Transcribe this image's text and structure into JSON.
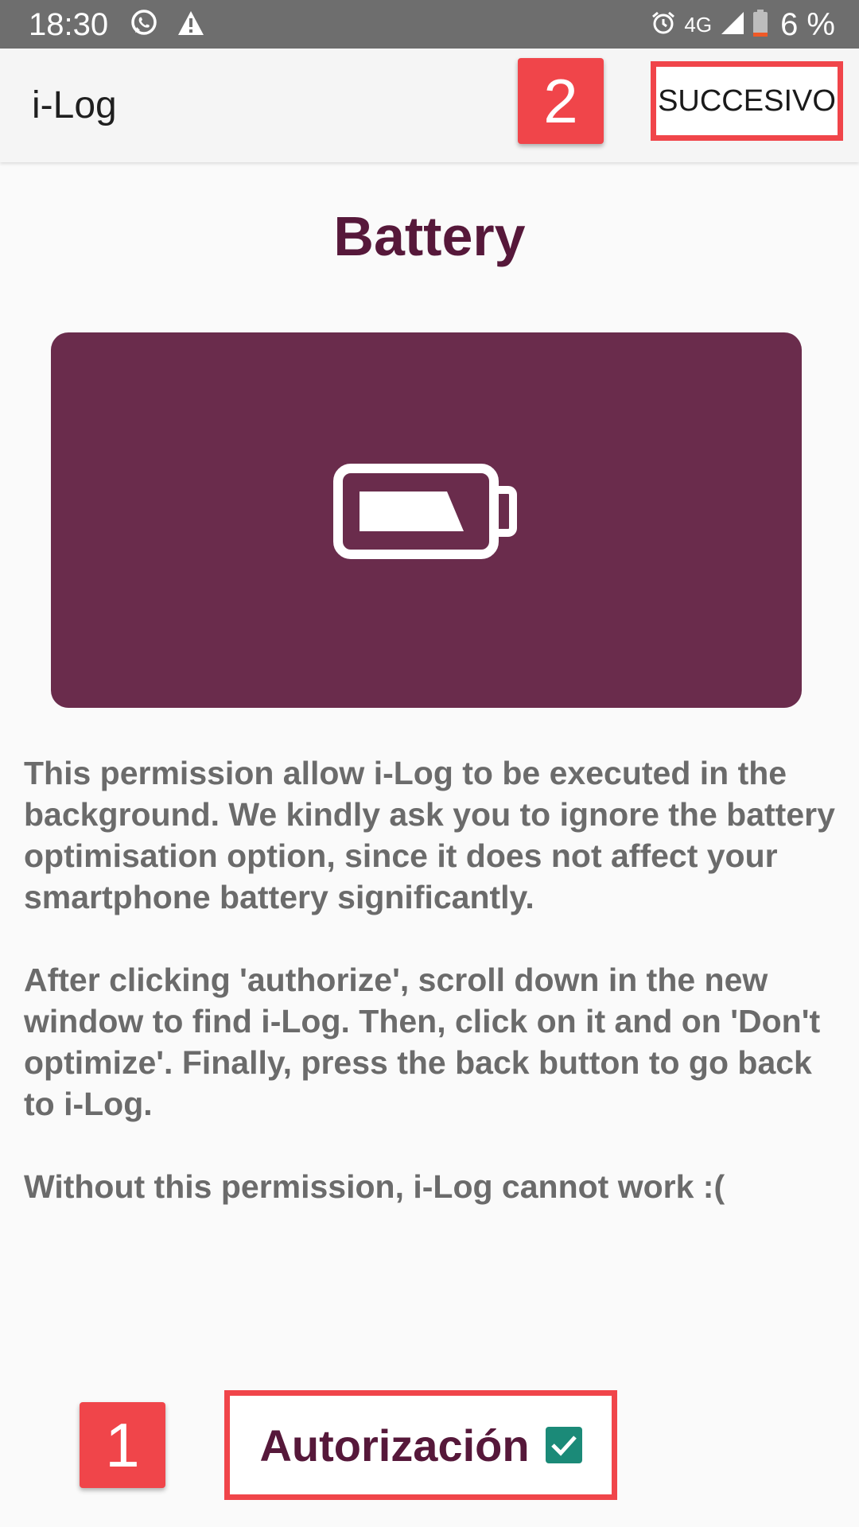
{
  "status_bar": {
    "time": "18:30",
    "network": "4G",
    "battery_percent": "6 %",
    "left_icons": [
      "whatsapp-icon",
      "warning-icon"
    ],
    "right_icons": [
      "alarm-icon",
      "signal-icon",
      "battery-icon"
    ]
  },
  "app_bar": {
    "title": "i-Log",
    "next_label": "SUCCESIVO"
  },
  "annotations": {
    "badge_1": "1",
    "badge_2": "2",
    "color": "#f0454a"
  },
  "page": {
    "title": "Battery",
    "hero_icon": "battery-icon",
    "hero_color": "#6a2c4c",
    "paragraphs": [
      "This permission allow i-Log to be executed in the background. We kindly ask you to ignore the battery optimisation option, since it does not affect your smartphone battery significantly.",
      "After clicking 'authorize', scroll down in the new window to find i-Log. Then, click on it and on 'Don't optimize'. Finally, press the back button to go back to i-Log.",
      "Without this permission, i-Log cannot work :("
    ]
  },
  "authorize": {
    "label": "Autorización",
    "checked": true,
    "checkbox_color": "#1b8a78"
  }
}
